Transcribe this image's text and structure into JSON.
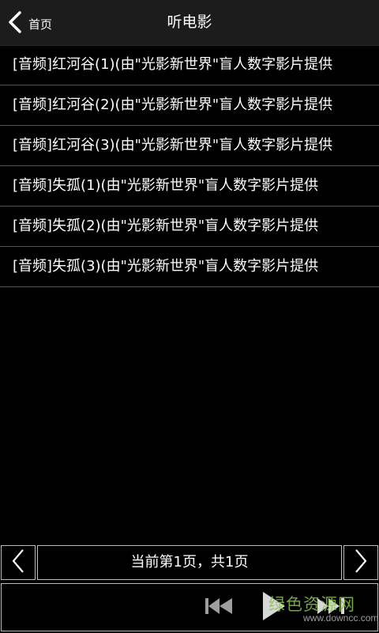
{
  "header": {
    "back_label": "首页",
    "title": "听电影"
  },
  "list": {
    "items": [
      "[音频]红河谷(1)(由\"光影新世界\"盲人数字影片提供",
      "[音频]红河谷(2)(由\"光影新世界\"盲人数字影片提供",
      "[音频]红河谷(3)(由\"光影新世界\"盲人数字影片提供",
      "[音频]失孤(1)(由\"光影新世界\"盲人数字影片提供",
      "[音频]失孤(2)(由\"光影新世界\"盲人数字影片提供",
      "[音频]失孤(3)(由\"光影新世界\"盲人数字影片提供"
    ]
  },
  "pager": {
    "status": "当前第1页，共1页"
  },
  "player": {
    "controls": [
      "rewind-icon",
      "play-icon",
      "fast-forward-icon"
    ]
  },
  "watermark": {
    "main": "绿色资源网",
    "sub": "www.downcc.com"
  },
  "colors": {
    "background": "#000000",
    "header": "#1c1c1c",
    "divider": "#555555",
    "border": "#bbbbbb",
    "watermark": "#8bc34a"
  }
}
